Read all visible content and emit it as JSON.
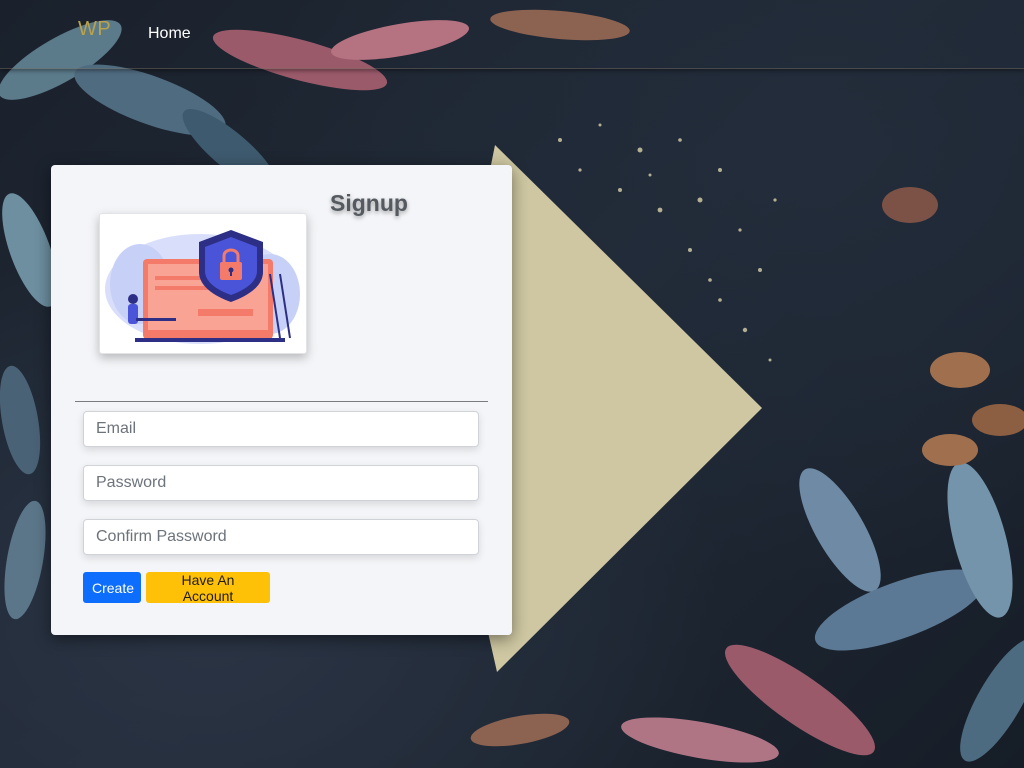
{
  "navbar": {
    "brand": "WP",
    "home_label": "Home"
  },
  "signup": {
    "title": "Signup",
    "illustration_icon": "security-lock-icon",
    "email_placeholder": "Email",
    "password_placeholder": "Password",
    "confirm_password_placeholder": "Confirm Password",
    "create_label": "Create",
    "have_account_label": "Have An Account"
  },
  "colors": {
    "brand": "#b9a24b",
    "primary": "#0d6efd",
    "warning": "#ffc107",
    "card_bg": "#f4f5f8"
  }
}
